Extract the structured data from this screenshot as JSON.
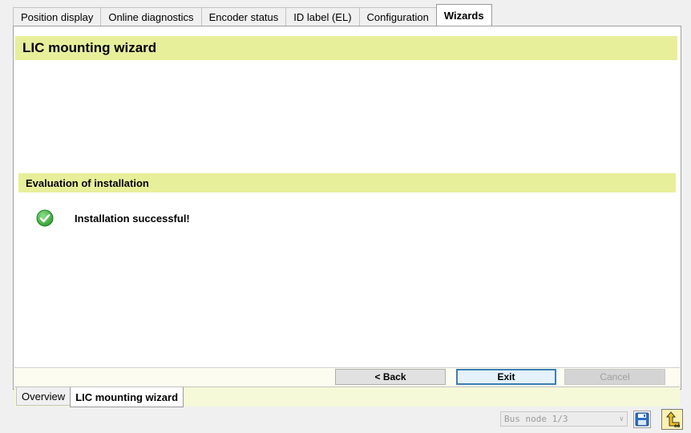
{
  "top_tabs": [
    {
      "label": "Position display",
      "active": false
    },
    {
      "label": "Online diagnostics",
      "active": false
    },
    {
      "label": "Encoder status",
      "active": false
    },
    {
      "label": "ID label (EL)",
      "active": false
    },
    {
      "label": "Configuration",
      "active": false
    },
    {
      "label": "Wizards",
      "active": true
    }
  ],
  "wizard": {
    "title": "LIC mounting wizard",
    "section_title": "Evaluation of installation",
    "status_text": "Installation successful!",
    "status_icon": "check-circle-icon",
    "status_color": "#3aa93a"
  },
  "buttons": {
    "back": "< Back",
    "exit": "Exit",
    "cancel": "Cancel"
  },
  "sub_tabs": [
    {
      "label": "Overview",
      "active": false
    },
    {
      "label": "LIC mounting wizard",
      "active": true
    }
  ],
  "status_bar": {
    "bus_node": "Bus node 1/3",
    "save_icon": "save-icon",
    "home_icon": "return-home-icon"
  },
  "colors": {
    "accent_bar": "#e8ef9a",
    "exit_border": "#3c7fb1"
  }
}
